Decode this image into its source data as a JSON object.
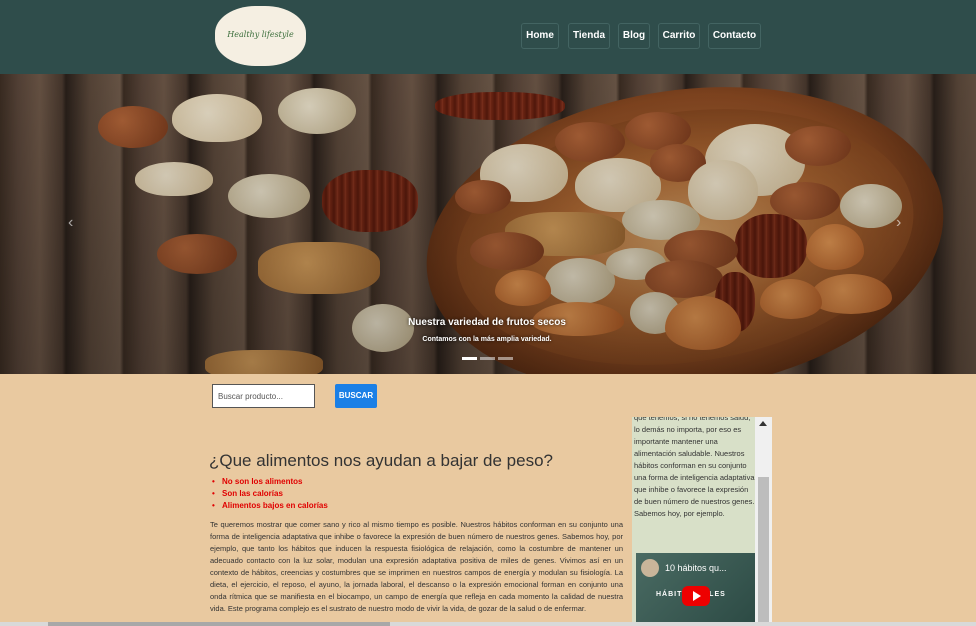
{
  "header": {
    "logo_text": "Healthy lifestyle",
    "nav": [
      "Home",
      "Tienda",
      "Blog",
      "Carrito",
      "Contacto"
    ]
  },
  "hero": {
    "title": "Nuestra variedad de frutos secos",
    "subtitle": "Contamos con la más amplia variedad.",
    "slides": 3,
    "active_slide": 1
  },
  "search": {
    "placeholder": "Buscar producto...",
    "button": "BUSCAR"
  },
  "article": {
    "title": "¿Que alimentos nos ayudan a bajar de peso?",
    "bullets": [
      "No son los alimentos",
      "Son las calorías",
      "Alimentos bajos en calorías"
    ],
    "body": "Te queremos mostrar que comer sano y rico al mismo tiempo es posible. Nuestros hábitos conforman en su conjunto una forma de inteligencia adaptativa que inhibe o favorece la expresión de buen número de nuestros genes. Sabemos hoy, por ejemplo, que tanto los hábitos que inducen la respuesta fisiológica de relajación, como la costumbre de mantener un adecuado contacto con la luz solar, modulan una expresión adaptativa positiva de miles de genes. Vivimos así en un contexto de hábitos, creencias y costumbres que se imprimen en nuestros campos de energía y modulan su fisiología. La dieta, el ejercicio, el reposo, el ayuno, la jornada laboral, el descanso o la expresión emocional forman en conjunto una onda rítmica que se manifiesta en el biocampo, un campo de energía que refleja en cada momento la calidad de nuestra vida. Este programa complejo es el sustrato de nuestro modo de vivir la vida, de gozar de la salud o de enfermar."
  },
  "sidebar": {
    "text": "que tenemos, si no tenemos salud, lo demás no importa, por eso es importante mantener una alimentación saludable. Nuestros hábitos conforman en su conjunto una forma de inteligencia adaptativa que inhibe o favorece la expresión de buen número de nuestros genes. Sabemos hoy, por ejemplo.",
    "video_title": "10 hábitos qu...",
    "video_overlay": "HÁBITOS    ABLES"
  },
  "colors": {
    "header_bg": "#2f4d4b",
    "page_bg": "#e9c9a0",
    "accent_button": "#1a7fe6",
    "bullet_red": "#e00000"
  }
}
